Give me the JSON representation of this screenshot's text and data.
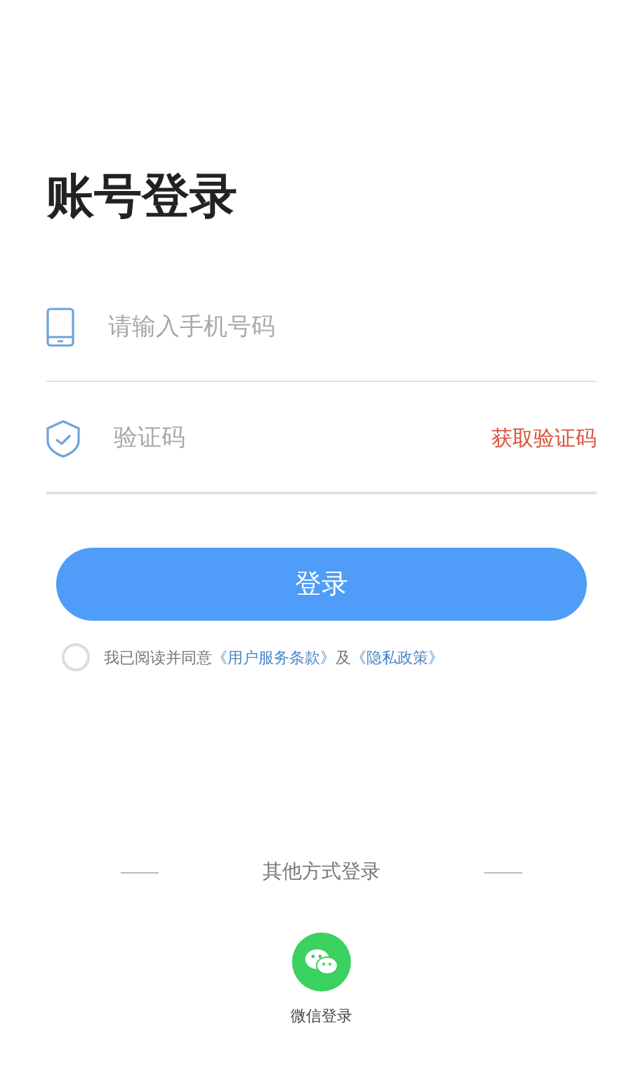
{
  "title": "账号登录",
  "fields": [
    {
      "kind": "phone",
      "placeholder": "请输入手机号码"
    },
    {
      "kind": "code",
      "placeholder": "验证码",
      "action": "获取验证码"
    }
  ],
  "login_button": "登录",
  "agreement": {
    "checked": false,
    "prefix": "我已阅读并同意",
    "terms_link": "《用户服务条款》",
    "conjunction": "及",
    "privacy_link": "《隐私政策》"
  },
  "other_login": {
    "heading": "其他方式登录",
    "options": [
      {
        "kind": "wechat",
        "label": "微信登录"
      }
    ]
  }
}
